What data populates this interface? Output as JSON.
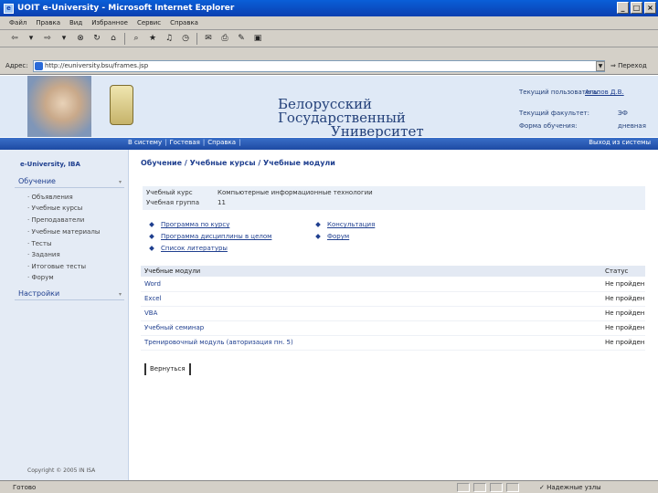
{
  "window": {
    "title": "UOIT e-University - Microsoft Internet Explorer",
    "min": "_",
    "max": "□",
    "close": "×"
  },
  "menu": [
    "Файл",
    "Правка",
    "Вид",
    "Избранное",
    "Сервис",
    "Справка"
  ],
  "toolbar": {
    "icons": [
      "back-icon",
      "forward-icon",
      "stop-icon",
      "refresh-icon",
      "home-icon",
      "search-icon",
      "favorites-icon",
      "media-icon",
      "history-icon",
      "mail-icon",
      "print-icon",
      "edit-icon",
      "discuss-icon"
    ]
  },
  "address": {
    "label": "Адрес:",
    "value": "http://euniversity.bsu/frames.jsp",
    "go": "Переход"
  },
  "header": {
    "logo_line1": "Белорусский",
    "logo_line2": "Государственный",
    "logo_line3": "Университет",
    "user_label": "Текущий пользователь:",
    "user_value": "Агапов Д.В.",
    "faculty_label": "Текущий факультет:",
    "faculty_value": "ЭФ",
    "form_label": "Форма обучения:",
    "form_value": "дневная"
  },
  "nav": {
    "items": [
      "В систему",
      "Гостевая",
      "Справка"
    ],
    "separator": "|",
    "logout": "Выход из системы"
  },
  "sidebar": {
    "brand": "e-University, IBA",
    "section1": "Обучение",
    "items": [
      "Объявления",
      "Учебные курсы",
      "Преподаватели",
      "Учебные материалы",
      "Тесты",
      "Задания",
      "Итоговые тесты",
      "Форум"
    ],
    "section2": "Настройки",
    "collapse": "▾",
    "copyright": "Copyright © 2005 IN ISA"
  },
  "main": {
    "breadcrumb": "Обучение / Учебные курсы / Учебные модули",
    "course_label": "Учебный курс",
    "course_value": "Компьютерные информационные технологии",
    "group_label": "Учебная группа",
    "group_value": "11",
    "links_left": [
      "Программа по курсу",
      "Программа дисциплины в целом",
      "Список литературы"
    ],
    "links_right": [
      "Консультация",
      "Форум"
    ],
    "table_header": [
      "Учебные модули",
      "Статус"
    ],
    "modules": [
      {
        "name": "Word",
        "status": "Не пройден"
      },
      {
        "name": "Excel",
        "status": "Не пройден"
      },
      {
        "name": "VBA",
        "status": "Не пройден"
      },
      {
        "name": "Учебный семинар",
        "status": "Не пройден"
      },
      {
        "name": "Тренировочный модуль (авторизация пн. 5)",
        "status": "Не пройден"
      }
    ],
    "back_button": "Вернуться"
  },
  "status": {
    "done": "Готово",
    "zone": "Надежные узлы"
  }
}
